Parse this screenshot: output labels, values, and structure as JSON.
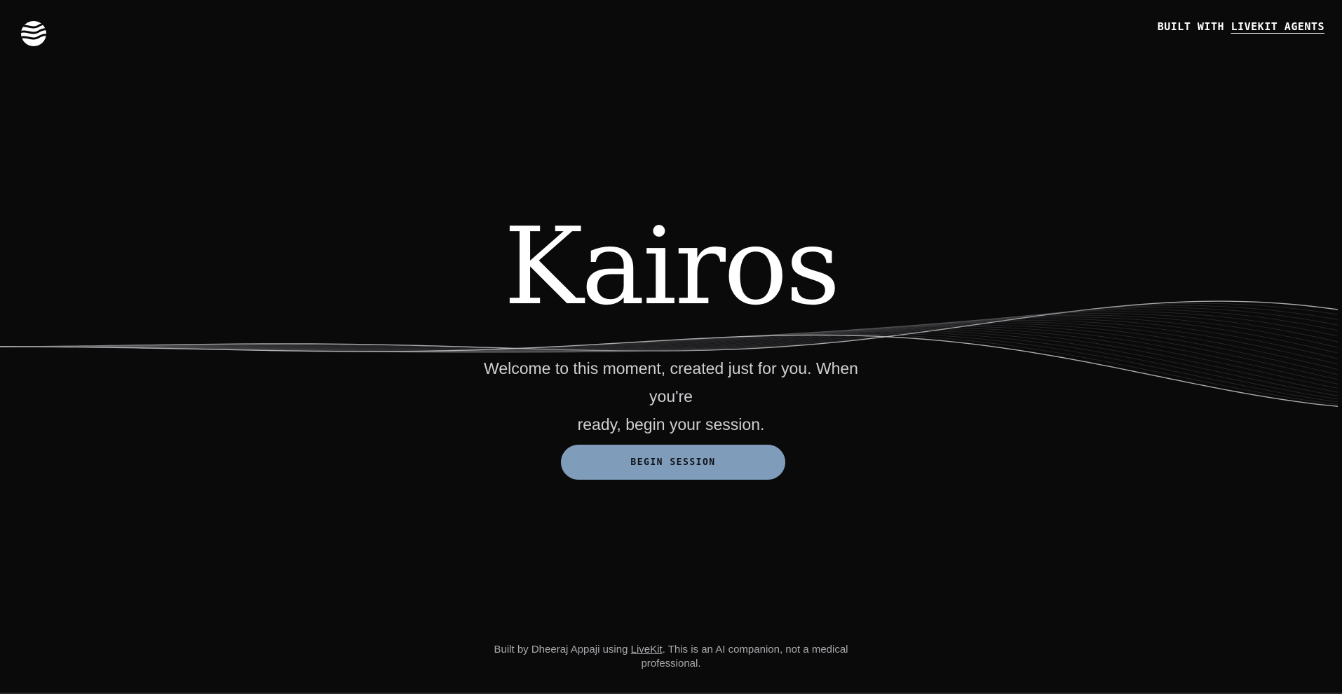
{
  "header": {
    "logo_icon": "wave-sphere-icon",
    "built_with_prefix": "BUILT WITH",
    "built_with_link": "LIVEKIT AGENTS"
  },
  "hero": {
    "title": "Kairos",
    "subtitle_line1": "Welcome to this moment, created just for you. When you're",
    "subtitle_line2": "ready, begin your session.",
    "button_label": "BEGIN SESSION"
  },
  "footer": {
    "prefix": "Built by Dheeraj Appaji using ",
    "link": "LiveKit",
    "suffix": ". This is an AI companion, not a medical",
    "line2": "professional."
  },
  "colors": {
    "background": "#0a0a0b",
    "accent_button": "#7f9dbb",
    "text_primary": "#ffffff",
    "text_secondary": "#cfcfd2",
    "text_muted": "#a9a9ad"
  }
}
